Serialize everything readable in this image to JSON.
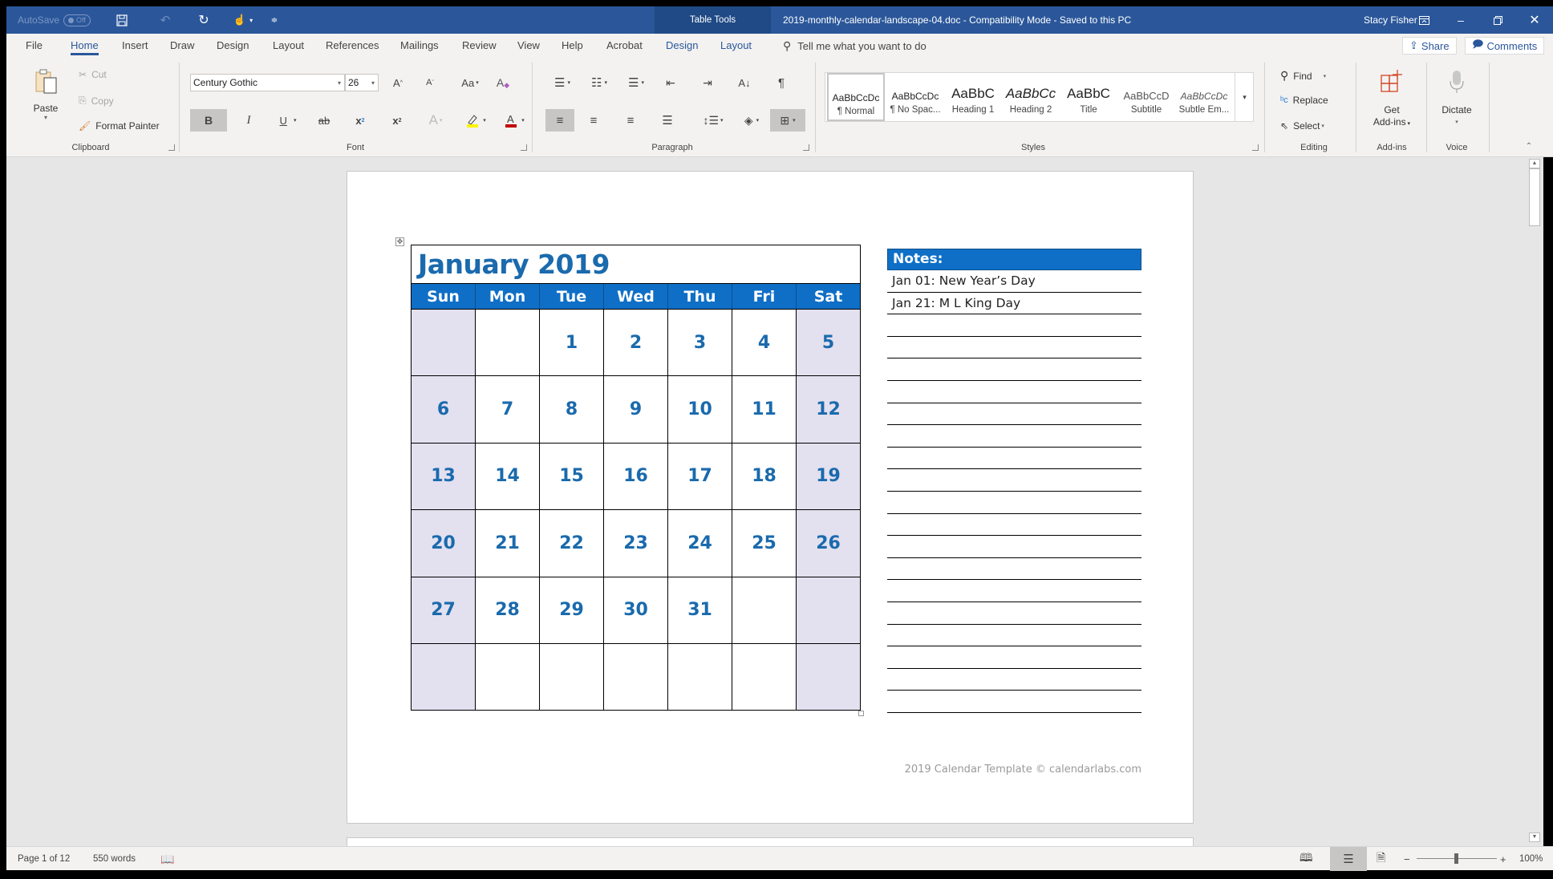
{
  "titlebar": {
    "autosave_label": "AutoSave",
    "autosave_state": "Off",
    "context_tab_group": "Table Tools",
    "document_title": "2019-monthly-calendar-landscape-04.doc  -  Compatibility Mode  -  Saved to this PC",
    "user_name": "Stacy Fisher",
    "icons": [
      "save-icon",
      "undo-icon",
      "redo-icon",
      "touch-mode-icon",
      "customize-qat-icon",
      "ribbon-display-icon",
      "minimize-icon",
      "restore-icon",
      "close-icon"
    ]
  },
  "tabs": [
    "File",
    "Home",
    "Insert",
    "Draw",
    "Design",
    "Layout",
    "References",
    "Mailings",
    "Review",
    "View",
    "Help",
    "Acrobat",
    "Design",
    "Layout"
  ],
  "active_tab": "Home",
  "tell_me_placeholder": "Tell me what you want to do",
  "share_label": "Share",
  "comments_label": "Comments",
  "ribbon": {
    "clipboard": {
      "label": "Clipboard",
      "paste": "Paste",
      "cut": "Cut",
      "copy": "Copy",
      "format_painter": "Format Painter"
    },
    "font": {
      "label": "Font",
      "font_name": "Century Gothic",
      "font_size": "26",
      "grow": "A",
      "shrink": "A",
      "change_case": "Aa",
      "bold": "B",
      "italic": "I",
      "underline": "U",
      "strike": "ab",
      "subscript": "x",
      "superscript": "x"
    },
    "paragraph": {
      "label": "Paragraph"
    },
    "styles": {
      "label": "Styles",
      "items": [
        {
          "preview": "AaBbCcDc",
          "name": "¶ Normal"
        },
        {
          "preview": "AaBbCcDc",
          "name": "¶ No Spac..."
        },
        {
          "preview": "AaBbC",
          "name": "Heading 1"
        },
        {
          "preview": "AaBbCc",
          "name": "Heading 2"
        },
        {
          "preview": "AaBbC",
          "name": "Title"
        },
        {
          "preview": "AaBbCcD",
          "name": "Subtitle"
        },
        {
          "preview": "AaBbCcDc",
          "name": "Subtle Em..."
        }
      ]
    },
    "editing": {
      "label": "Editing",
      "find": "Find",
      "replace": "Replace",
      "select": "Select"
    },
    "addins": {
      "label": "Add-ins",
      "get": "Get",
      "addins": "Add-ins"
    },
    "voice": {
      "label": "Voice",
      "dictate": "Dictate"
    }
  },
  "calendar": {
    "title": "January 2019",
    "weekdays": [
      "Sun",
      "Mon",
      "Tue",
      "Wed",
      "Thu",
      "Fri",
      "Sat"
    ],
    "weeks": [
      [
        "",
        "",
        "1",
        "2",
        "3",
        "4",
        "5"
      ],
      [
        "6",
        "7",
        "8",
        "9",
        "10",
        "11",
        "12"
      ],
      [
        "13",
        "14",
        "15",
        "16",
        "17",
        "18",
        "19"
      ],
      [
        "20",
        "21",
        "22",
        "23",
        "24",
        "25",
        "26"
      ],
      [
        "27",
        "28",
        "29",
        "30",
        "31",
        "",
        ""
      ],
      [
        "",
        "",
        "",
        "",
        "",
        "",
        ""
      ]
    ],
    "accent_color": "#0f6fc6",
    "weekend_color": "#e3e0ef"
  },
  "notes": {
    "heading": "Notes:",
    "lines": [
      "Jan 01: New Year’s Day",
      "Jan 21: M L King Day",
      "",
      "",
      "",
      "",
      "",
      "",
      "",
      "",
      "",
      "",
      "",
      "",
      "",
      "",
      "",
      "",
      "",
      ""
    ]
  },
  "footer_text": "2019 Calendar Template © calendarlabs.com",
  "status": {
    "page": "Page 1 of 12",
    "words": "550 words",
    "zoom": "100%",
    "zoom_minus": "−",
    "zoom_plus": "+"
  }
}
